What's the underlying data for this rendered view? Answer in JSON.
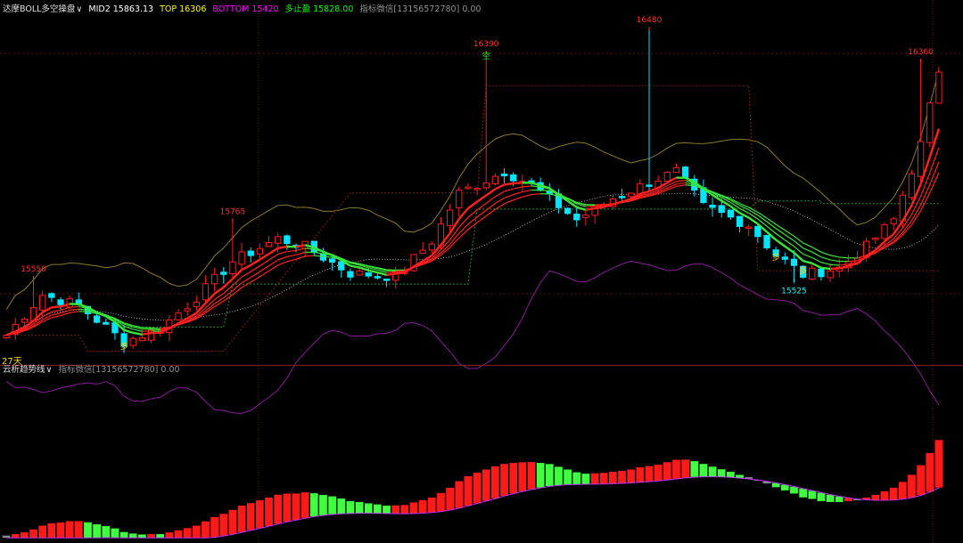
{
  "top_panel": {
    "indicator_name": "达摩BOLL多空操盘",
    "chevron": "∨",
    "mid_label": "MID2 15863.13",
    "top_label": "TOP 16306",
    "bottom_label": "BOTTOM 15420",
    "bull_stop_label": "多止盈 15828.00",
    "misc_label": "指标微信[13156572780] 0.00",
    "days_label": "27天",
    "colors": {
      "mid": "#ffffff",
      "top": "#ffff00",
      "bottom": "#ff00ff",
      "bull_stop": "#00ff00",
      "misc": "#909090",
      "name": "#e0e0e0"
    }
  },
  "bottom_panel": {
    "indicator_name": "云析趋势线",
    "chevron": "∨",
    "misc_label": "指标微信[13156572780] 0.00"
  },
  "chart_data": [
    {
      "type": "candlestick",
      "title": "达摩BOLL多空操盘",
      "x_count": 104,
      "ylim": [
        15225,
        16520
      ],
      "price_labels": [
        {
          "text": "15550",
          "index": 3,
          "value": 15550,
          "color": "#ff3030"
        },
        {
          "text": "15765",
          "index": 25,
          "value": 15765,
          "color": "#ff3030"
        },
        {
          "text": "16390",
          "index": 53,
          "value": 16390,
          "color": "#ff3030"
        },
        {
          "text": "16480",
          "index": 71,
          "value": 16480,
          "color": "#ff3030"
        },
        {
          "text": "15525",
          "index": 87,
          "value": 15525,
          "color": "#00ffff"
        },
        {
          "text": "16360",
          "index": 101,
          "value": 16360,
          "color": "#ff3030"
        }
      ],
      "signals": [
        {
          "text": "空",
          "index": 53,
          "value": 16360,
          "color": "#00ff00"
        },
        {
          "text": "多",
          "index": 13,
          "value": 15278,
          "color": "#ffd700"
        },
        {
          "text": "多",
          "index": 85,
          "value": 15610,
          "color": "#ffd700"
        },
        {
          "text": "多",
          "index": 88,
          "value": 15560,
          "color": "#ffd700"
        }
      ],
      "series_colors": {
        "up": "#ff1a1a",
        "down": "#00e5ff",
        "trend_up": "#ff2020",
        "trend_down": "#39e639",
        "upper_band": "#8a7a2a",
        "lower_band": "#8a1a9a",
        "mid_band": "#b0b0b0",
        "stop_line": "#1f9a3a",
        "resist_line": "#7a1e1e"
      }
    },
    {
      "type": "bar",
      "title": "云析趋势线",
      "x_count": 104,
      "ylim": [
        0,
        100
      ],
      "series_colors": {
        "up": "#ff1a1a",
        "down": "#40ff40",
        "neutral": "#8a8a8a",
        "signal": "#c030ff"
      }
    }
  ]
}
